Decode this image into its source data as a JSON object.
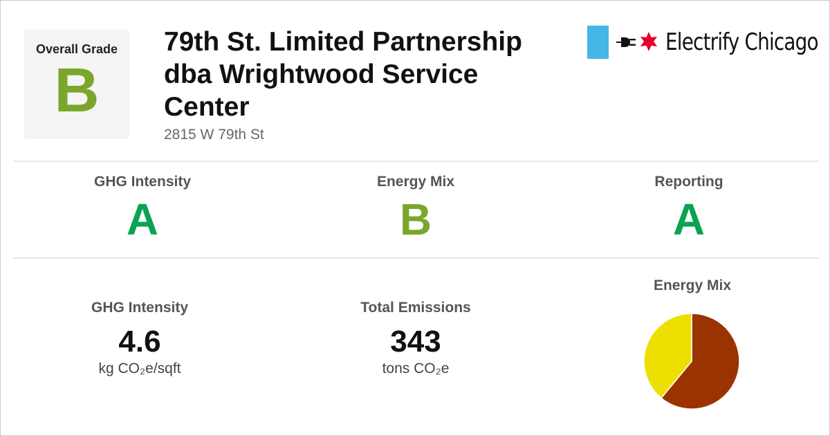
{
  "overall": {
    "label": "Overall Grade",
    "grade": "B"
  },
  "building": {
    "name": "79th St. Limited Partnership dba Wrightwood Service Center",
    "address": "2815 W 79th St"
  },
  "brand": {
    "name": "Electrify Chicago",
    "colors": {
      "flag_blue": "#45b6e5",
      "star_red": "#e4002b"
    }
  },
  "grades": [
    {
      "label": "GHG Intensity",
      "grade": "A"
    },
    {
      "label": "Energy Mix",
      "grade": "B"
    },
    {
      "label": "Reporting",
      "grade": "A"
    }
  ],
  "stats": {
    "ghg_intensity": {
      "label": "GHG Intensity",
      "value": "4.6",
      "unit": "kg CO₂e/sqft"
    },
    "total_emissions": {
      "label": "Total Emissions",
      "value": "343",
      "unit": "tons CO₂e"
    }
  },
  "energy_mix": {
    "label": "Energy Mix",
    "slices": [
      {
        "value": 0.61,
        "color": "#9a3300"
      },
      {
        "value": 0.39,
        "color": "#ede000"
      }
    ]
  },
  "colors": {
    "grade_A": "#0aa351",
    "grade_B": "#7aa62b"
  }
}
